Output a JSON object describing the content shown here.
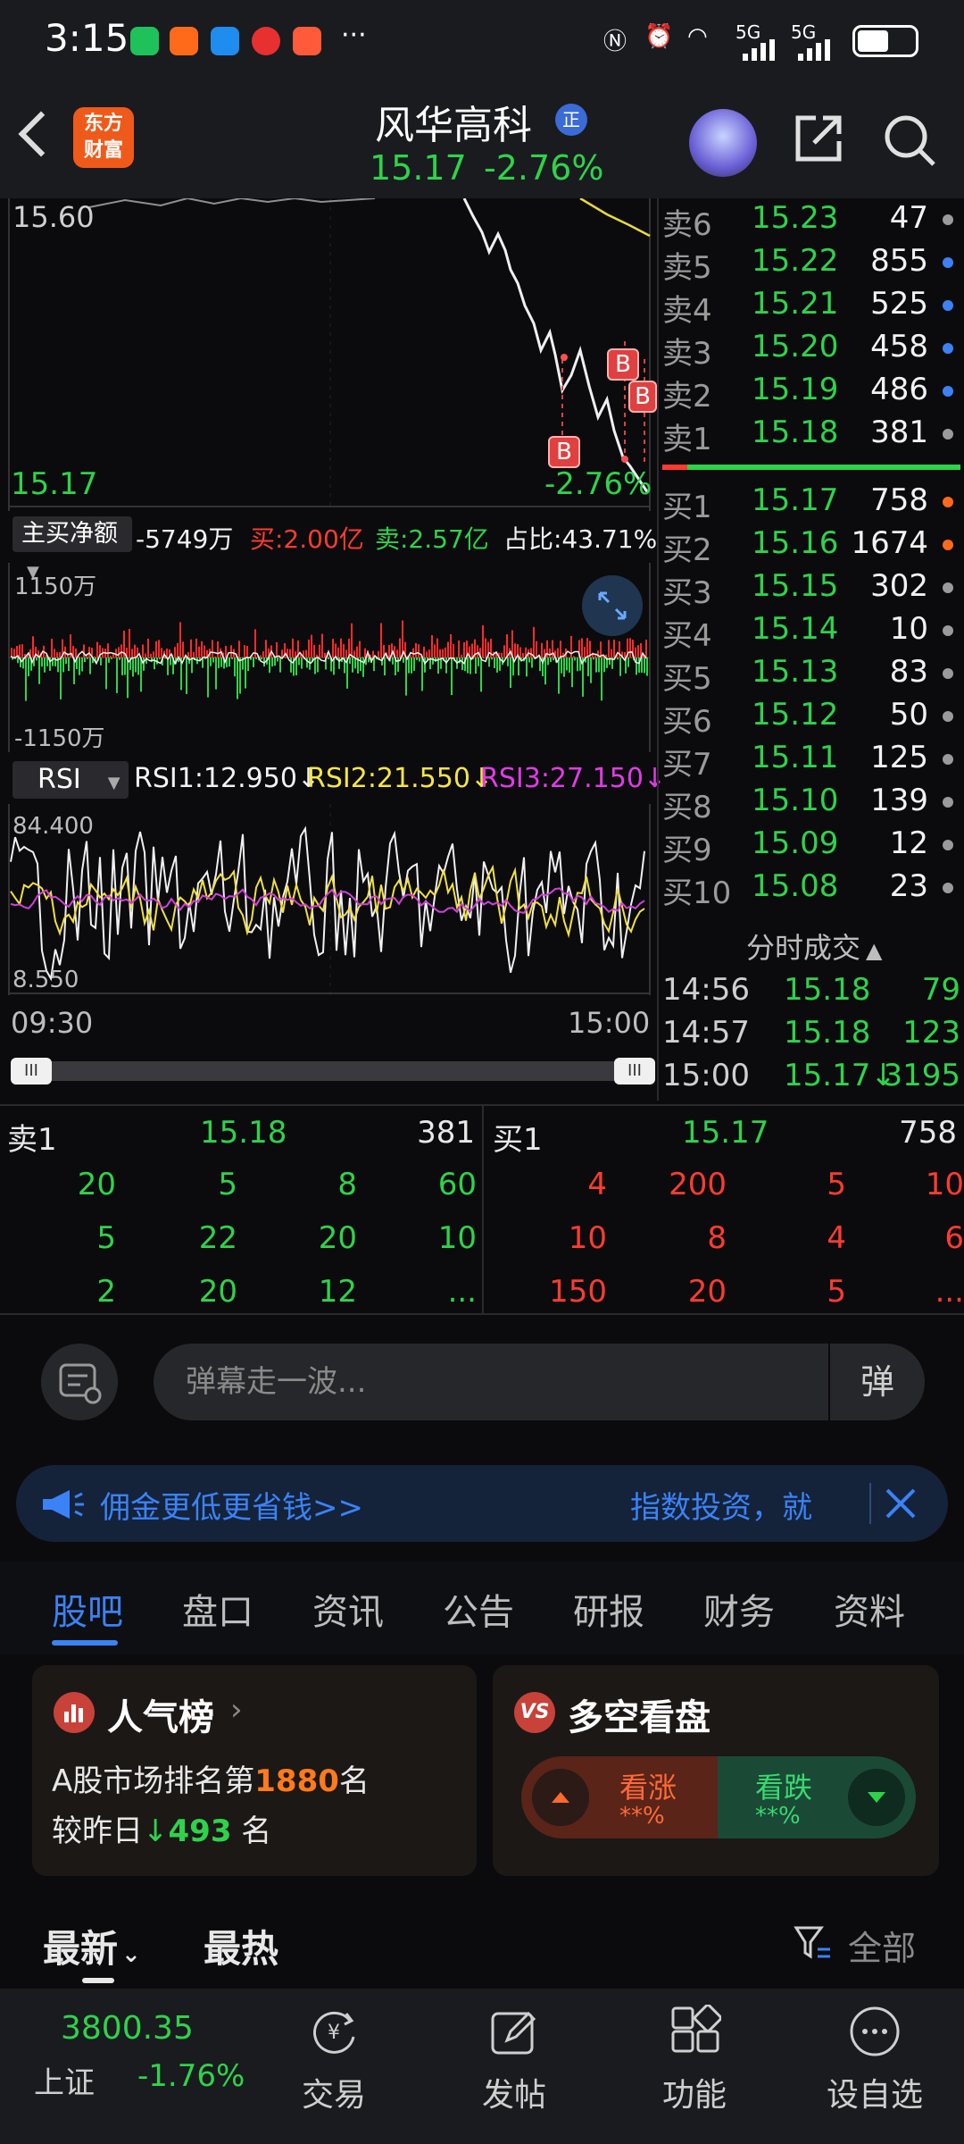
{
  "status_bar": {
    "time": "3:15",
    "dots": "···",
    "signal1": "5G",
    "signal2": "5G"
  },
  "header": {
    "logo_line1": "东方",
    "logo_line2": "财富",
    "stock_name": "风华高科",
    "badge": "正",
    "price": "15.17",
    "change_pct": "-2.76%"
  },
  "price_chart": {
    "top_label": "15.60",
    "bottom_label": "15.17",
    "change_label": "-2.76%",
    "markers": [
      "B",
      "B",
      "B"
    ]
  },
  "flow": {
    "tag": "主买净额",
    "net": "-5749万",
    "buy": "买:2.00亿",
    "sell": "卖:2.57亿",
    "ratio": "占比:43.71%",
    "axis_top": "1150万",
    "axis_bottom": "-1150万"
  },
  "rsi": {
    "tag": "RSI",
    "rsi1": "RSI1:12.950↓",
    "rsi2": "RSI2:21.550↓",
    "rsi3": "RSI3:27.150↓",
    "axis_top": "84.400",
    "axis_bottom": "8.550"
  },
  "time_axis": {
    "start": "09:30",
    "end": "15:00"
  },
  "scroll_handle_glyph": "III",
  "colors": {
    "green": "#2ed34b",
    "red": "#ff3b30",
    "blue": "#3b82f6",
    "orange": "#ff7a1a"
  },
  "order_book": {
    "asks": [
      {
        "label": "卖6",
        "price": "15.23",
        "volume": "47",
        "dot": "gray"
      },
      {
        "label": "卖5",
        "price": "15.22",
        "volume": "855",
        "dot": "blue"
      },
      {
        "label": "卖4",
        "price": "15.21",
        "volume": "525",
        "dot": "blue"
      },
      {
        "label": "卖3",
        "price": "15.20",
        "volume": "458",
        "dot": "blue"
      },
      {
        "label": "卖2",
        "price": "15.19",
        "volume": "486",
        "dot": "blue"
      },
      {
        "label": "卖1",
        "price": "15.18",
        "volume": "381",
        "dot": "gray"
      }
    ],
    "bids": [
      {
        "label": "买1",
        "price": "15.17",
        "volume": "758",
        "dot": "orange"
      },
      {
        "label": "买2",
        "price": "15.16",
        "volume": "1674",
        "dot": "orange"
      },
      {
        "label": "买3",
        "price": "15.15",
        "volume": "302",
        "dot": "gray"
      },
      {
        "label": "买4",
        "price": "15.14",
        "volume": "10",
        "dot": "gray"
      },
      {
        "label": "买5",
        "price": "15.13",
        "volume": "83",
        "dot": "gray"
      },
      {
        "label": "买6",
        "price": "15.12",
        "volume": "50",
        "dot": "gray"
      },
      {
        "label": "买7",
        "price": "15.11",
        "volume": "125",
        "dot": "gray"
      },
      {
        "label": "买8",
        "price": "15.10",
        "volume": "139",
        "dot": "gray"
      },
      {
        "label": "买9",
        "price": "15.09",
        "volume": "12",
        "dot": "gray"
      },
      {
        "label": "买10",
        "price": "15.08",
        "volume": "23",
        "dot": "gray"
      }
    ]
  },
  "trades": {
    "title": "分时成交",
    "rows": [
      {
        "time": "14:56",
        "price": "15.18",
        "volume": "79"
      },
      {
        "time": "14:57",
        "price": "15.18",
        "volume": "123"
      },
      {
        "time": "15:00",
        "price": "15.17↓",
        "volume": "3195"
      }
    ]
  },
  "queue": {
    "sell_label": "卖1",
    "sell_price": "15.18",
    "sell_volume": "381",
    "buy_label": "买1",
    "buy_price": "15.17",
    "buy_volume": "758",
    "sell_rows": [
      [
        "20",
        "5",
        "8",
        "60"
      ],
      [
        "5",
        "22",
        "20",
        "10"
      ],
      [
        "2",
        "20",
        "12",
        "..."
      ]
    ],
    "buy_rows": [
      [
        "4",
        "200",
        "5",
        "10"
      ],
      [
        "10",
        "8",
        "4",
        "6"
      ],
      [
        "150",
        "20",
        "5",
        "..."
      ]
    ]
  },
  "danmu": {
    "placeholder": "弹幕走一波...",
    "button": "弹"
  },
  "banner": {
    "left_text": "佣金更低更省钱>>",
    "right_text": "指数投资，就"
  },
  "tabs": [
    "股吧",
    "盘口",
    "资讯",
    "公告",
    "研报",
    "财务",
    "资料"
  ],
  "popularity": {
    "title": "人气榜",
    "rank_prefix": "A股市场排名第",
    "rank": "1880",
    "rank_suffix": "名",
    "compare_prefix": "较昨日",
    "compare_value": "493",
    "compare_suffix": "名"
  },
  "sentiment": {
    "title": "多空看盘",
    "bull_label": "看涨",
    "bull_value": "**%",
    "bear_label": "看跌",
    "bear_value": "**%"
  },
  "feed": {
    "sort_latest": "最新",
    "sort_hot": "最热",
    "filter": "全部"
  },
  "bottom_nav": {
    "index_value": "3800.35",
    "index_name": "上证",
    "index_change": "-1.76%",
    "items": [
      "交易",
      "发帖",
      "功能",
      "设自选"
    ]
  }
}
